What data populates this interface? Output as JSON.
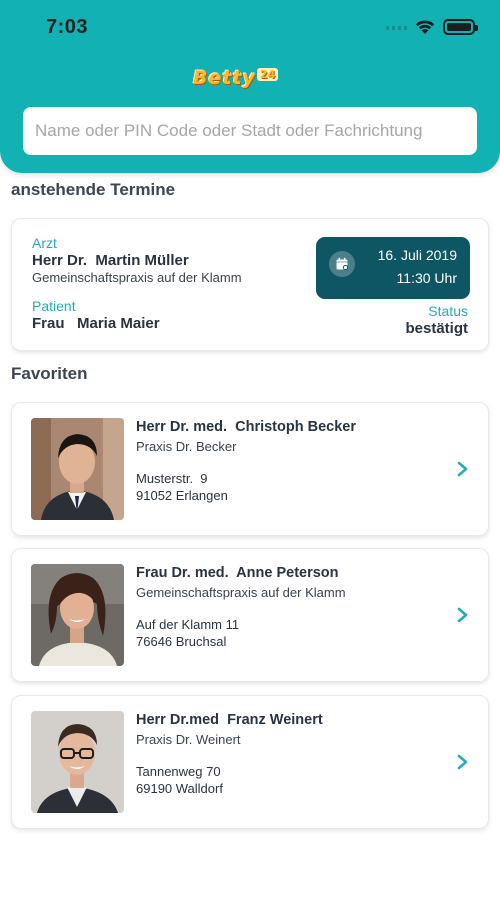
{
  "status_bar": {
    "time": "7:03"
  },
  "brand": {
    "name": "Betty",
    "sup": "24"
  },
  "search": {
    "placeholder": "Name oder PIN Code oder Stadt oder Fachrichtung"
  },
  "upcoming": {
    "title": "anstehende Termine",
    "doctor_label": "Arzt",
    "doctor_name": "Herr Dr.  Martin Müller",
    "doctor_practice": "Gemeinschaftspraxis auf der Klamm",
    "patient_label": "Patient",
    "patient_name": "Frau   Maria Maier",
    "date": "16. Juli 2019",
    "time": "11:30 Uhr",
    "status_label": "Status",
    "status_value": "bestätigt"
  },
  "favorites": {
    "title": "Favoriten",
    "items": [
      {
        "name": "Herr Dr. med.  Christoph Becker",
        "practice": "Praxis Dr. Becker",
        "street": "Musterstr.  9",
        "city": "91052 Erlangen"
      },
      {
        "name": "Frau Dr. med.  Anne Peterson",
        "practice": "Gemeinschaftspraxis auf der Klamm",
        "street": "Auf der Klamm 11",
        "city": "76646 Bruchsal"
      },
      {
        "name": "Herr Dr.med  Franz Weinert",
        "practice": "Praxis Dr. Weinert",
        "street": "Tannenweg 70",
        "city": "69190 Walldorf"
      }
    ]
  },
  "colors": {
    "header": "#12b1b3",
    "accent": "#27aab0",
    "date_box": "#0e5663",
    "logo": "#ffb52e"
  }
}
